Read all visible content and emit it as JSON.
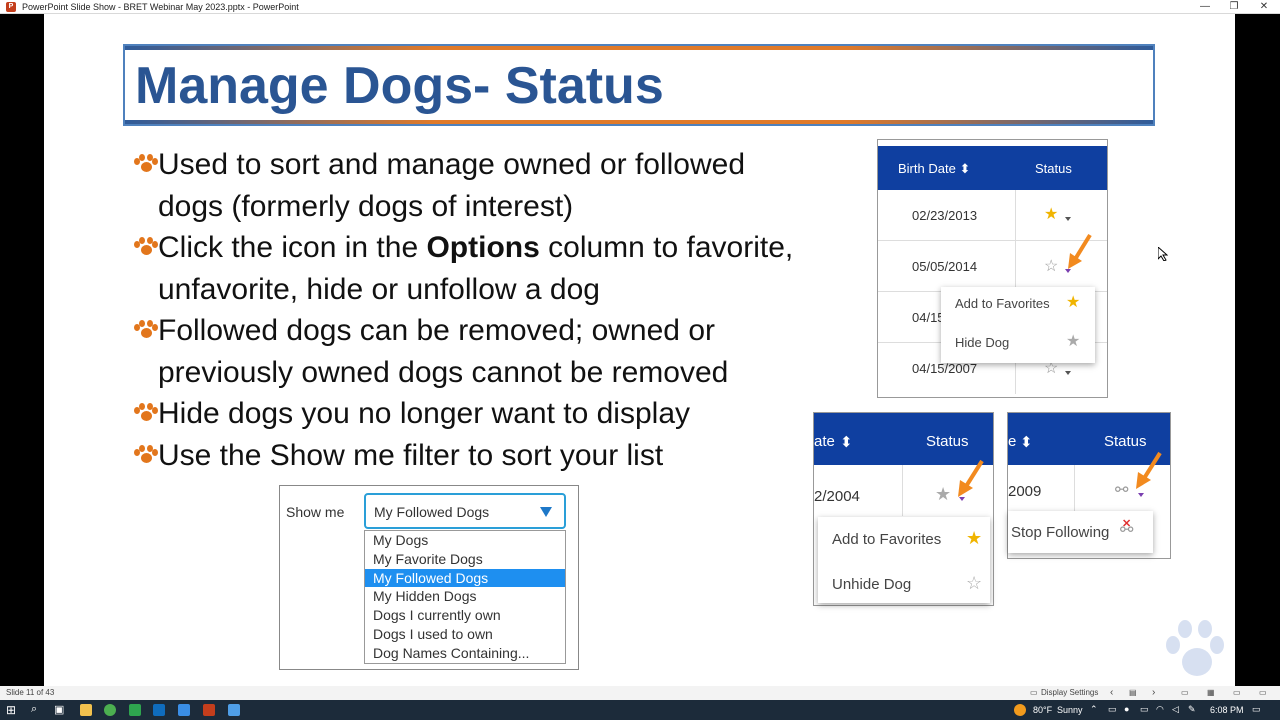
{
  "window": {
    "title": "PowerPoint Slide Show  -  BRET Webinar May 2023.pptx - PowerPoint",
    "minimize": "—",
    "restore": "❐",
    "close": "✕"
  },
  "slide": {
    "title": "Manage Dogs-  Status",
    "bullets": [
      {
        "text": "Used to sort and manage owned or followed dogs (formerly dogs of interest)"
      },
      {
        "pre": "Click the icon in the ",
        "bold": "Options",
        "post": " column to favorite, unfavorite, hide or unfollow a dog"
      },
      {
        "text": "Followed dogs can be removed; owned or previously owned dogs cannot be removed"
      },
      {
        "text": "Hide dogs you no longer want to display"
      },
      {
        "text": "Use the Show me filter to sort your list"
      }
    ],
    "show_me": {
      "label": "Show me",
      "selected": "My Followed Dogs",
      "options": [
        "My Dogs",
        "My Favorite Dogs",
        "My Followed Dogs",
        "My Hidden Dogs",
        "Dogs I currently own",
        "Dogs I used to own",
        "Dog Names Containing..."
      ]
    },
    "table1": {
      "col1": "Birth Date",
      "col2": "Status",
      "rows": [
        "02/23/2013",
        "05/05/2014",
        "04/15",
        "04/15/2007"
      ],
      "popup": [
        "Add to Favorites",
        "Hide Dog"
      ]
    },
    "table2": {
      "col1": "ate",
      "col2": "Status",
      "row": "2/2004",
      "popup": [
        "Add to Favorites",
        "Unhide Dog"
      ]
    },
    "table3": {
      "col1": "e",
      "col2": "Status",
      "row": "2009",
      "popup": [
        "Stop Following"
      ]
    }
  },
  "statusbar": {
    "slide_counter": "Slide 11 of 43",
    "display_settings": "Display Settings"
  },
  "taskbar": {
    "temperature": "80°F",
    "weather": "Sunny",
    "time": "6:08 PM"
  },
  "colors": {
    "title_blue": "#2a5593",
    "table_header": "#0f3fa0",
    "paw_orange": "#e2761c",
    "selection_blue": "#1e8ff0",
    "star_gold": "#f0b400"
  }
}
